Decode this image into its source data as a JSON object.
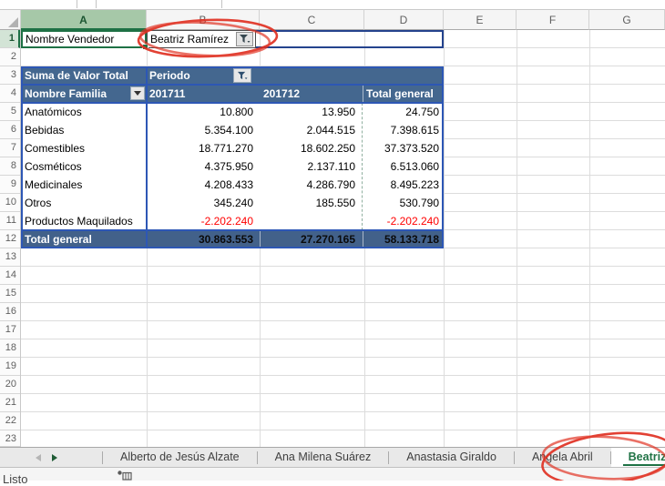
{
  "app": {
    "name": "Excel",
    "view": "worksheet"
  },
  "grid": {
    "columns": [
      "A",
      "B",
      "C",
      "D",
      "E",
      "F",
      "G"
    ],
    "rows": [
      "1",
      "2",
      "3",
      "4",
      "5",
      "6",
      "7",
      "8",
      "9",
      "10",
      "11",
      "12",
      "13",
      "14",
      "15",
      "16",
      "17",
      "18",
      "19",
      "20",
      "21",
      "22",
      "23"
    ],
    "selected_column": "A",
    "selected_row": "1"
  },
  "report_filter": {
    "label": "Nombre Vendedor",
    "value": "Beatriz Ramírez"
  },
  "pivot": {
    "measure": "Suma de Valor Total",
    "column_field": "Periodo",
    "row_field": "Nombre Familia",
    "columns": [
      "201711",
      "201712",
      "Total general"
    ],
    "rows": [
      {
        "label": "Anatómicos",
        "values": [
          "10.800",
          "13.950",
          "24.750"
        ]
      },
      {
        "label": "Bebidas",
        "values": [
          "5.354.100",
          "2.044.515",
          "7.398.615"
        ]
      },
      {
        "label": "Comestibles",
        "values": [
          "18.771.270",
          "18.602.250",
          "37.373.520"
        ]
      },
      {
        "label": "Cosméticos",
        "values": [
          "4.375.950",
          "2.137.110",
          "6.513.060"
        ]
      },
      {
        "label": "Medicinales",
        "values": [
          "4.208.433",
          "4.286.790",
          "8.495.223"
        ]
      },
      {
        "label": "Otros",
        "values": [
          "345.240",
          "185.550",
          "530.790"
        ]
      },
      {
        "label": "Productos Maquilados",
        "values": [
          "-2.202.240",
          "",
          "-2.202.240"
        ]
      }
    ],
    "grand_total": {
      "label": "Total general",
      "values": [
        "30.863.553",
        "27.270.165",
        "58.133.718"
      ]
    }
  },
  "tabs": {
    "items": [
      {
        "label": "Alberto de Jesús Alzate",
        "active": false
      },
      {
        "label": "Ana Milena Suárez",
        "active": false
      },
      {
        "label": "Anastasia Giraldo",
        "active": false
      },
      {
        "label": "Angela Abril",
        "active": false
      },
      {
        "label": "Beatriz Ram",
        "active": true
      }
    ]
  },
  "status": {
    "mode": "Listo"
  },
  "icons": {
    "report_filter_button": "funnel-icon",
    "periodo_filter_button": "funnel-icon",
    "familia_dropdown": "chevron-down-icon",
    "sheet_nav_prev": "arrow-left-icon",
    "sheet_nav_next": "arrow-right-icon",
    "status_icon": "macro-record-icon"
  },
  "annotations": {
    "color": "#E03022",
    "shapes": [
      "hand-drawn-ellipse-around-filter-value",
      "hand-drawn-ellipse-around-active-tab"
    ]
  },
  "colors": {
    "pivot_header": "#44678F",
    "pivot_total_row": "#42618A",
    "pivot_border": "#2D57B5",
    "filter_range_border": "#24438D",
    "negative_value": "#FF0000",
    "excel_green": "#1E7145",
    "active_tab_text": "#217346",
    "annotation_red": "#E03022"
  }
}
